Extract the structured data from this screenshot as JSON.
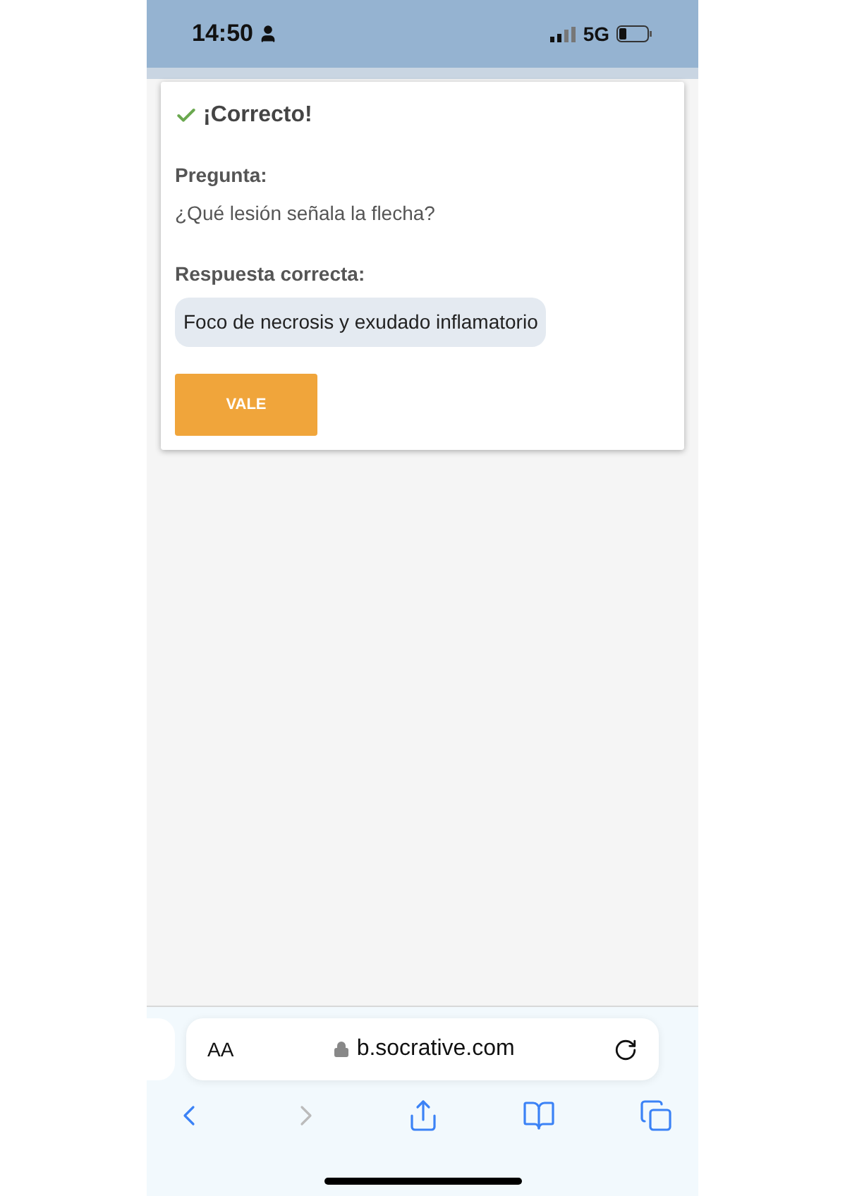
{
  "status_bar": {
    "time": "14:50",
    "network": "5G"
  },
  "result": {
    "title": "¡Correcto!",
    "correct": true,
    "question_label": "Pregunta:",
    "question": "¿Qué lesión señala la flecha?",
    "answer_label": "Respuesta correcta:",
    "answer": "Foco de necrosis y exudado inflamatorio",
    "button": "VALE"
  },
  "browser": {
    "text_size": "AA",
    "url": "b.socrative.com",
    "toolbar": [
      {
        "kind": "back",
        "disabled": false
      },
      {
        "kind": "forward",
        "disabled": true
      },
      {
        "kind": "share",
        "disabled": false
      },
      {
        "kind": "bookmarks",
        "disabled": false
      },
      {
        "kind": "tabs",
        "disabled": false
      }
    ]
  }
}
